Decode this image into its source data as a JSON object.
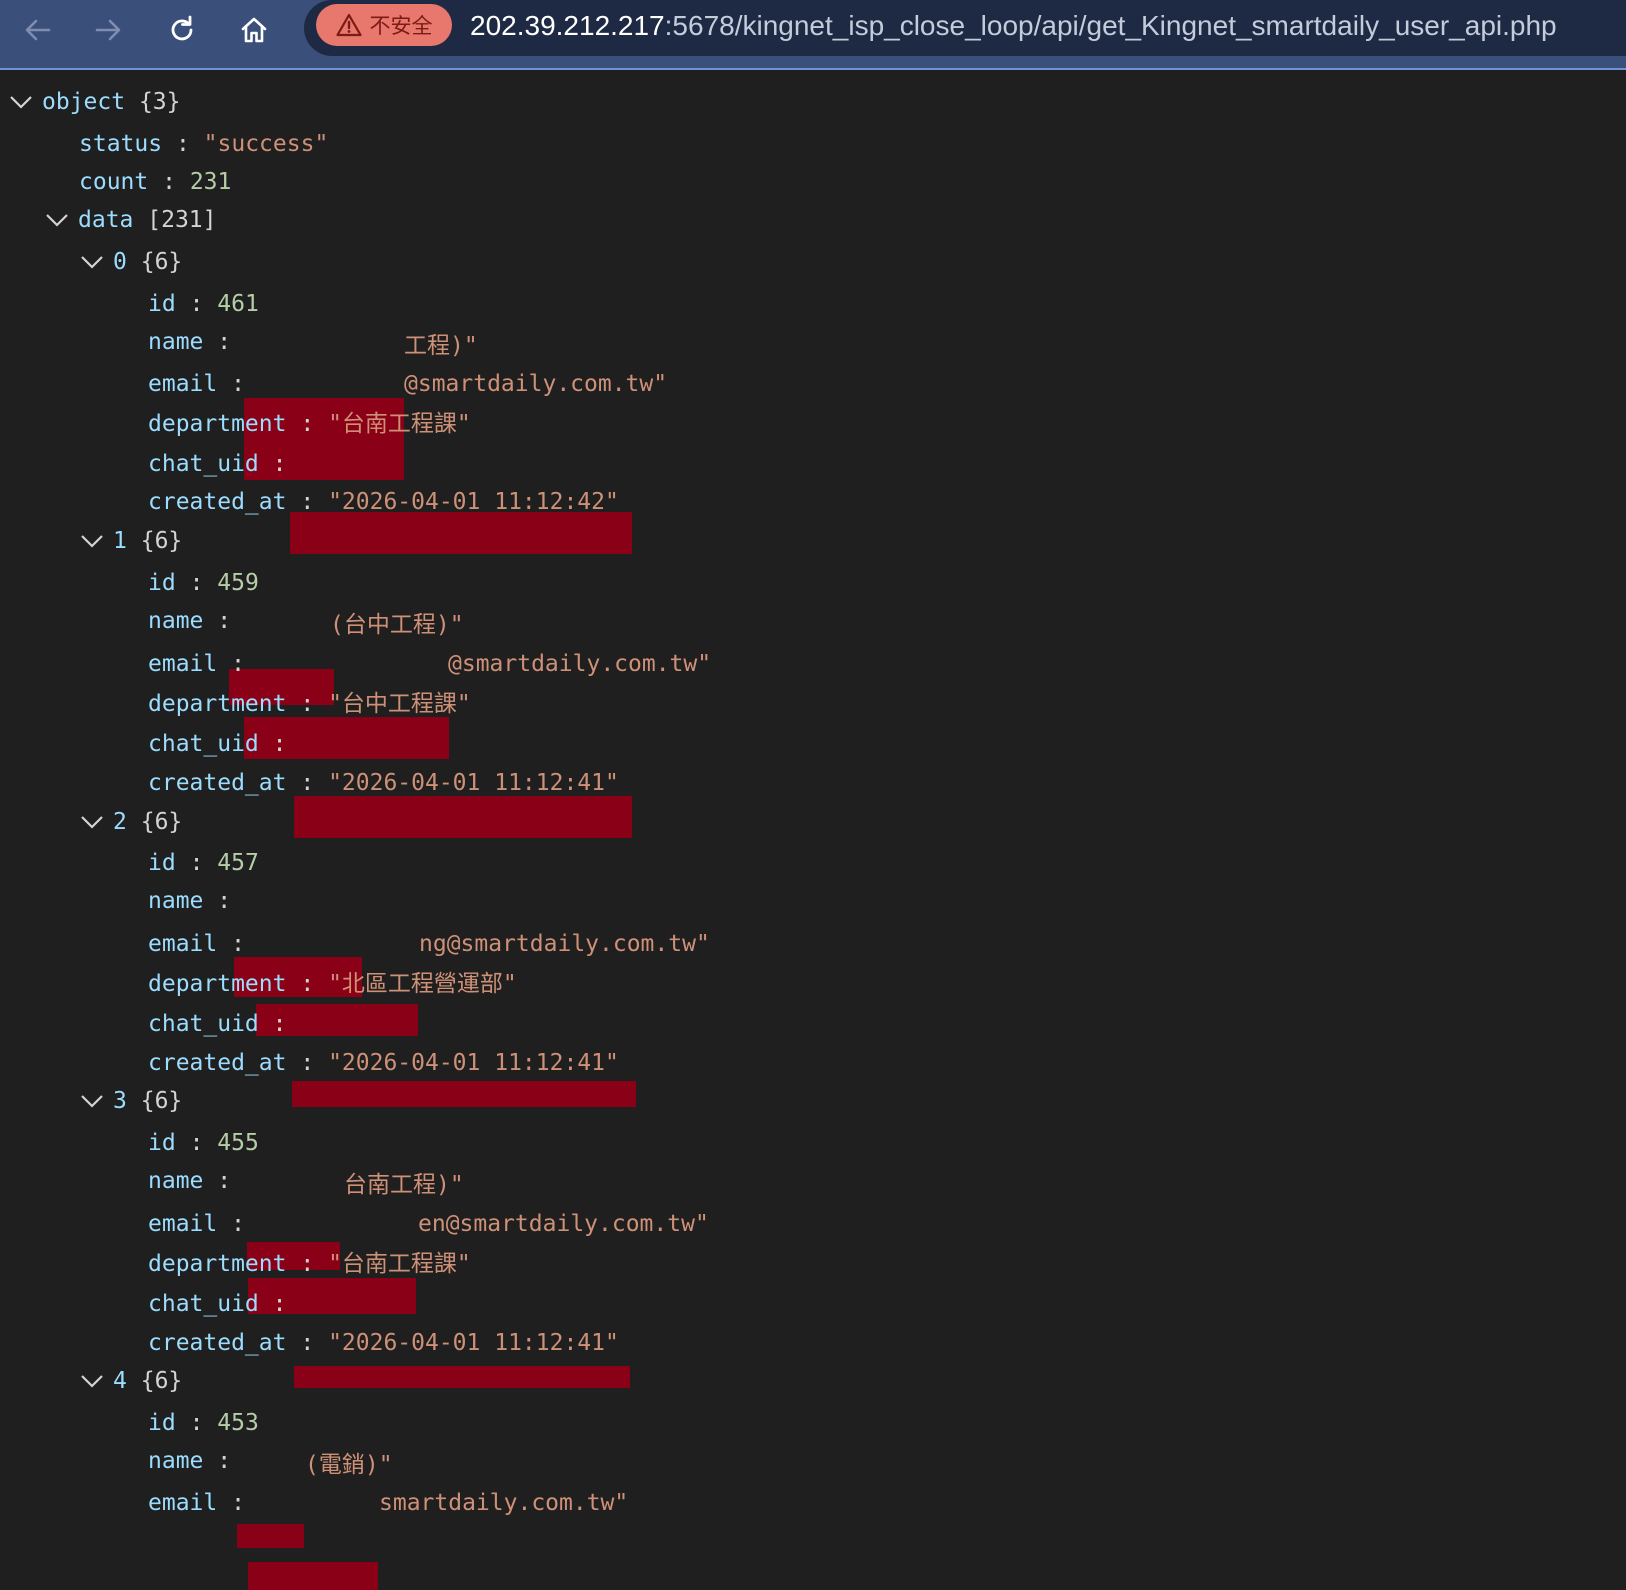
{
  "browser": {
    "not_secure_label": "不安全",
    "url_host": "202.39.212.217",
    "url_path": ":5678/kingnet_isp_close_loop/api/get_Kingnet_smartdaily_user_api.php"
  },
  "json": {
    "root_label": "object",
    "root_count": "{3}",
    "status_key": "status",
    "status_value": "\"success\"",
    "count_key": "count",
    "count_value": "231",
    "data_key": "data",
    "data_count": "[231]",
    "field_keys": {
      "id": "id",
      "name": "name",
      "email": "email",
      "department": "department",
      "chat_uid": "chat_uid",
      "created_at": "created_at"
    },
    "colon": ":",
    "items": [
      {
        "index": "0",
        "size": "{6}",
        "id": "461",
        "name_visible": "工程)\"",
        "email_visible": "@smartdaily.com.tw\"",
        "department": "\"台南工程課\"",
        "created_at": "\"2026-04-01 11:12:42\""
      },
      {
        "index": "1",
        "size": "{6}",
        "id": "459",
        "name_visible": "(台中工程)\"",
        "email_visible": "@smartdaily.com.tw\"",
        "department": "\"台中工程課\"",
        "created_at": "\"2026-04-01 11:12:41\""
      },
      {
        "index": "2",
        "size": "{6}",
        "id": "457",
        "name_visible": "",
        "email_visible": "ng@smartdaily.com.tw\"",
        "department": "\"北區工程營運部\"",
        "created_at": "\"2026-04-01 11:12:41\""
      },
      {
        "index": "3",
        "size": "{6}",
        "id": "455",
        "name_visible": "台南工程)\"",
        "email_visible": "en@smartdaily.com.tw\"",
        "department": "\"台南工程課\"",
        "created_at": "\"2026-04-01 11:12:41\""
      },
      {
        "index": "4",
        "size": "{6}",
        "id": "453",
        "name_visible": "(電銷)\"",
        "email_visible": "smartdaily.com.tw\""
      }
    ]
  }
}
